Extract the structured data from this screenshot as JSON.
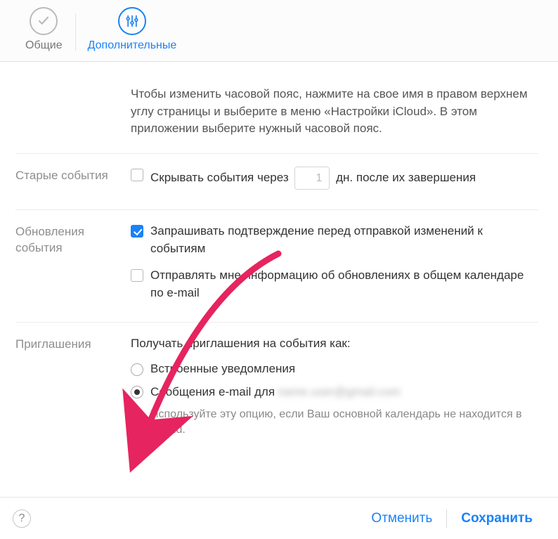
{
  "tabs": {
    "general": "Общие",
    "advanced": "Дополнительные"
  },
  "timezone": {
    "hint": "Чтобы изменить часовой пояс, нажмите на свое имя в правом верхнем углу страницы и выберите в меню «Настройки iCloud». В этом приложении выберите нужный часовой пояс."
  },
  "old_events": {
    "label": "Старые события",
    "hide_prefix": "Скрывать события через",
    "days_value": "1",
    "hide_suffix": "дн. после их завершения",
    "hide_checked": false
  },
  "updates": {
    "label": "Обновления события",
    "confirm_label": "Запрашивать подтверждение перед отправкой изменений к событиям",
    "confirm_checked": true,
    "email_label": "Отправлять мне информацию об обновлениях в общем календаре по e-mail",
    "email_checked": false
  },
  "invites": {
    "label": "Приглашения",
    "heading": "Получать приглашения на события как:",
    "option_inapp": "Встроенные уведомления",
    "option_email_prefix": "Сообщения e-mail для",
    "option_email_blurred": "name.user@gmail.com",
    "selected": "email",
    "hint": "Используйте эту опцию, если Ваш основной календарь не находится в iCloud."
  },
  "footer": {
    "help": "?",
    "cancel": "Отменить",
    "save": "Сохранить"
  },
  "colors": {
    "accent": "#1a82f7",
    "arrow": "#e6245f"
  }
}
